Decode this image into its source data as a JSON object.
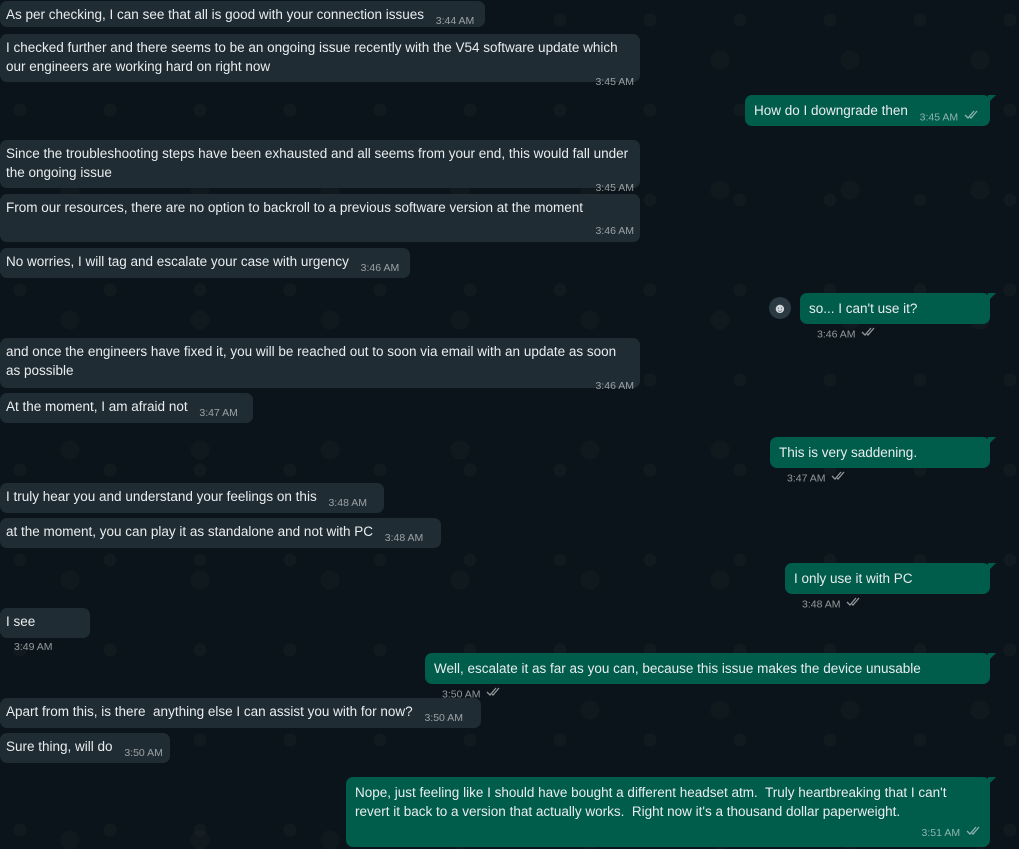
{
  "messages": [
    {
      "dir": "in",
      "text": "As per checking, I can see that all is good with your connection issues",
      "time": "3:44 AM"
    },
    {
      "dir": "in",
      "text": "I checked further and there seems to be an ongoing issue recently with the V54 software update which our engineers are working hard on right now",
      "time": "3:45 AM"
    },
    {
      "dir": "out",
      "text": "How do I downgrade then",
      "time": "3:45 AM"
    },
    {
      "dir": "in",
      "text": "Since the troubleshooting steps have been exhausted and all seems from your end, this would fall under the ongoing issue",
      "time": "3:45 AM"
    },
    {
      "dir": "in",
      "text": "From our resources, there are no option to backroll to a previous software version at the moment",
      "time": "3:46 AM"
    },
    {
      "dir": "in",
      "text": "No worries, I will tag and escalate your case with urgency",
      "time": "3:46 AM"
    },
    {
      "dir": "out",
      "text": "so... I can't use it?",
      "time": "3:46 AM"
    },
    {
      "dir": "in",
      "text": "and once the engineers have fixed it, you will be reached out to soon via email with an update as soon as possible",
      "time": "3:46 AM"
    },
    {
      "dir": "in",
      "text": "At the moment, I am afraid not",
      "time": "3:47 AM"
    },
    {
      "dir": "out",
      "text": "This is very saddening.",
      "time": "3:47 AM"
    },
    {
      "dir": "in",
      "text": "I truly hear you and understand your feelings on this",
      "time": "3:48 AM"
    },
    {
      "dir": "in",
      "text": "at the moment, you can play it as standalone and not with PC",
      "time": "3:48 AM"
    },
    {
      "dir": "out",
      "text": "I only use it with PC",
      "time": "3:48 AM"
    },
    {
      "dir": "in",
      "text": "I see",
      "time": "3:49 AM"
    },
    {
      "dir": "out",
      "text": "Well, escalate it as far as you can, because this issue makes the device unusable",
      "time": "3:50 AM"
    },
    {
      "dir": "in",
      "text": "Apart from this, is there  anything else I can assist you with for now?",
      "time": "3:50 AM"
    },
    {
      "dir": "in",
      "text": "Sure thing, will do",
      "time": "3:50 AM"
    },
    {
      "dir": "out",
      "text": "Nope, just feeling like I should have bought a different headset atm.  Truly heartbreaking that I can't revert it back to a version that actually works.  Right now it's a thousand dollar paperweight.",
      "time": "3:51 AM"
    }
  ],
  "icons": {
    "read_receipt": "double-check-icon",
    "reaction": "smiley-reaction-icon"
  },
  "colors": {
    "background": "#0b141a",
    "incoming": "#202c33",
    "outgoing": "#005c4b",
    "text": "#e9edef"
  }
}
